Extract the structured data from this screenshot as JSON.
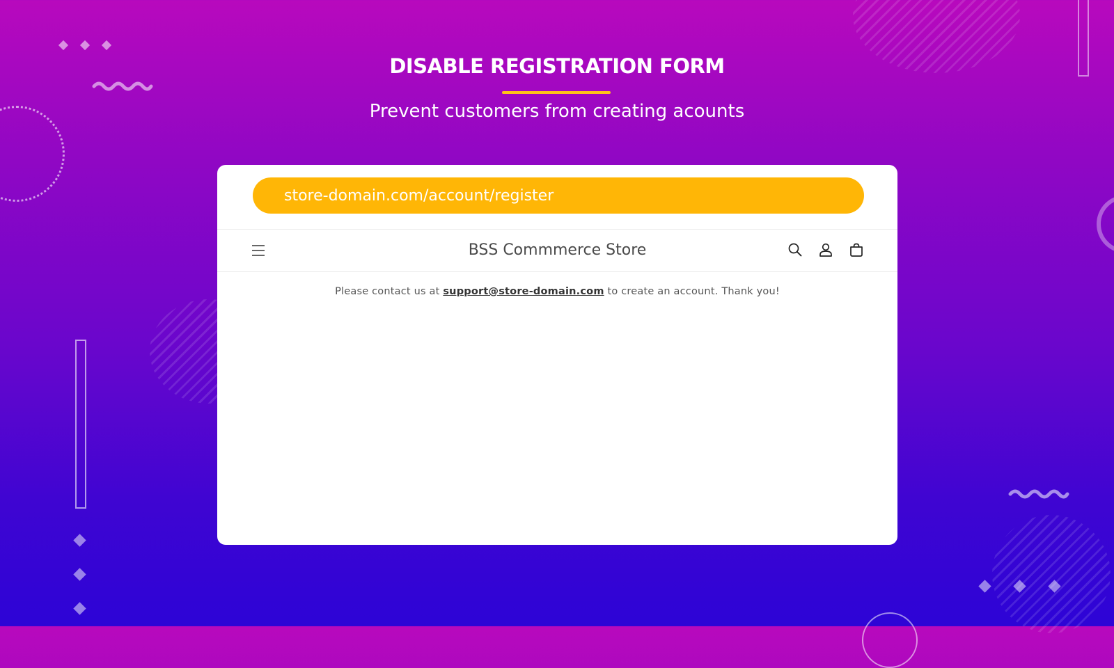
{
  "banner": {
    "title": "DISABLE REGISTRATION FORM",
    "subtitle": "Prevent customers from creating acounts"
  },
  "browser": {
    "url": "store-domain.com/account/register"
  },
  "store": {
    "name": "BSS Commmerce Store",
    "icons": [
      "menu-icon",
      "search-icon",
      "account-icon",
      "cart-icon"
    ]
  },
  "notice": {
    "before": "Please contact us at",
    "email": "support@store-domain.com",
    "after": "to create an account. Thank you!"
  },
  "colors": {
    "accent": "#ffb606",
    "underline": "#ffc21a",
    "gradient_top": "#b809bd",
    "gradient_bottom": "#2d04d6"
  }
}
